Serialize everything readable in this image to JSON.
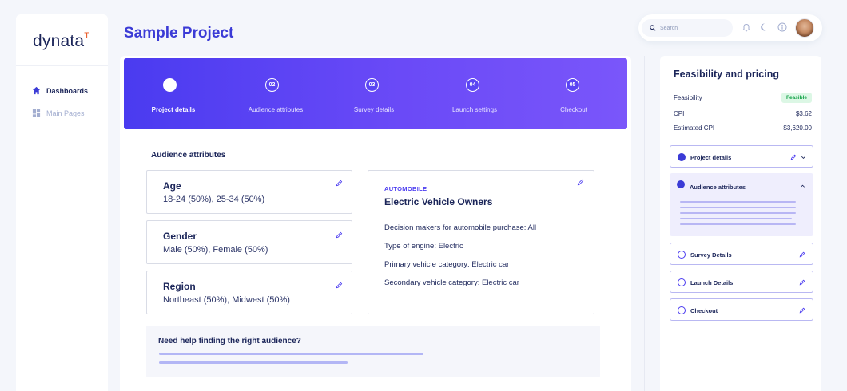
{
  "brand": {
    "logo_text": "dynata",
    "logo_mark": "T"
  },
  "sidebar": {
    "items": [
      {
        "label": "Dashboards",
        "icon": "home-icon",
        "active": true
      },
      {
        "label": "Main Pages",
        "icon": "grid-icon",
        "active": false
      }
    ]
  },
  "header": {
    "title": "Sample Project",
    "search_placeholder": "Search"
  },
  "stepper": {
    "steps": [
      {
        "num": "",
        "label": "Project details",
        "active": true
      },
      {
        "num": "02",
        "label": "Audience attributes",
        "active": false
      },
      {
        "num": "03",
        "label": "Survey details",
        "active": false
      },
      {
        "num": "04",
        "label": "Launch settings",
        "active": false
      },
      {
        "num": "05",
        "label": "Checkout",
        "active": false
      }
    ]
  },
  "audience": {
    "section_title": "Audience attributes",
    "cards": [
      {
        "title": "Age",
        "value": "18-24 (50%), 25-34 (50%)"
      },
      {
        "title": "Gender",
        "value": "Male (50%), Female (50%)"
      },
      {
        "title": "Region",
        "value": "Northeast (50%), Midwest (50%)"
      }
    ],
    "auto": {
      "tag": "AUTOMOBILE",
      "name": "Electric Vehicle Owners",
      "rows": [
        {
          "key": "Decision makers for automobile purchase:",
          "val": "All"
        },
        {
          "key": "Type of engine:",
          "val": "Electric"
        },
        {
          "key": "Primary vehicle category:",
          "val": "Electric car"
        },
        {
          "key": "Secondary vehicle category:",
          "val": "Electric car"
        }
      ]
    },
    "help_text": "Need help finding the right audience?"
  },
  "feasibility": {
    "title": "Feasibility and pricing",
    "feasibility_label": "Feasibility",
    "feasibility_badge": "Feasible",
    "cpi_label": "CPI",
    "cpi_value": "$3.62",
    "est_label": "Estimated CPI",
    "est_value": "$3,620.00",
    "sections": [
      {
        "label": "Project details"
      },
      {
        "label": "Audience attributes"
      },
      {
        "label": "Survey Details"
      },
      {
        "label": "Launch Details"
      },
      {
        "label": "Checkout"
      }
    ]
  },
  "colors": {
    "accent": "#3b3bd6",
    "stepper_start": "#4a3bf0",
    "stepper_end": "#7a56fa",
    "feasible": "#16a34a"
  }
}
